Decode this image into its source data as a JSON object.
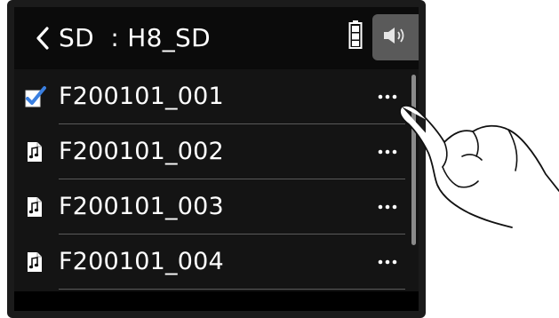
{
  "header": {
    "title": "SD  : H8_SD",
    "back_icon": "chevron-left-icon",
    "battery_icon": "battery-full-icon",
    "speaker_icon": "speaker-icon"
  },
  "files": [
    {
      "name": "F200101_001",
      "icon": "checked-file-icon",
      "selected": true,
      "more_label": "•••"
    },
    {
      "name": "F200101_002",
      "icon": "audio-file-icon",
      "selected": false,
      "more_label": "•••"
    },
    {
      "name": "F200101_003",
      "icon": "audio-file-icon",
      "selected": false,
      "more_label": "•••"
    },
    {
      "name": "F200101_004",
      "icon": "audio-file-icon",
      "selected": false,
      "more_label": "•••"
    }
  ],
  "colors": {
    "background": "#141414",
    "header": "#0b0b0b",
    "text": "#ffffff",
    "divider": "#5a5a5a",
    "speaker_button": "#5a5a5a",
    "checkmark": "#3a7fe0"
  }
}
